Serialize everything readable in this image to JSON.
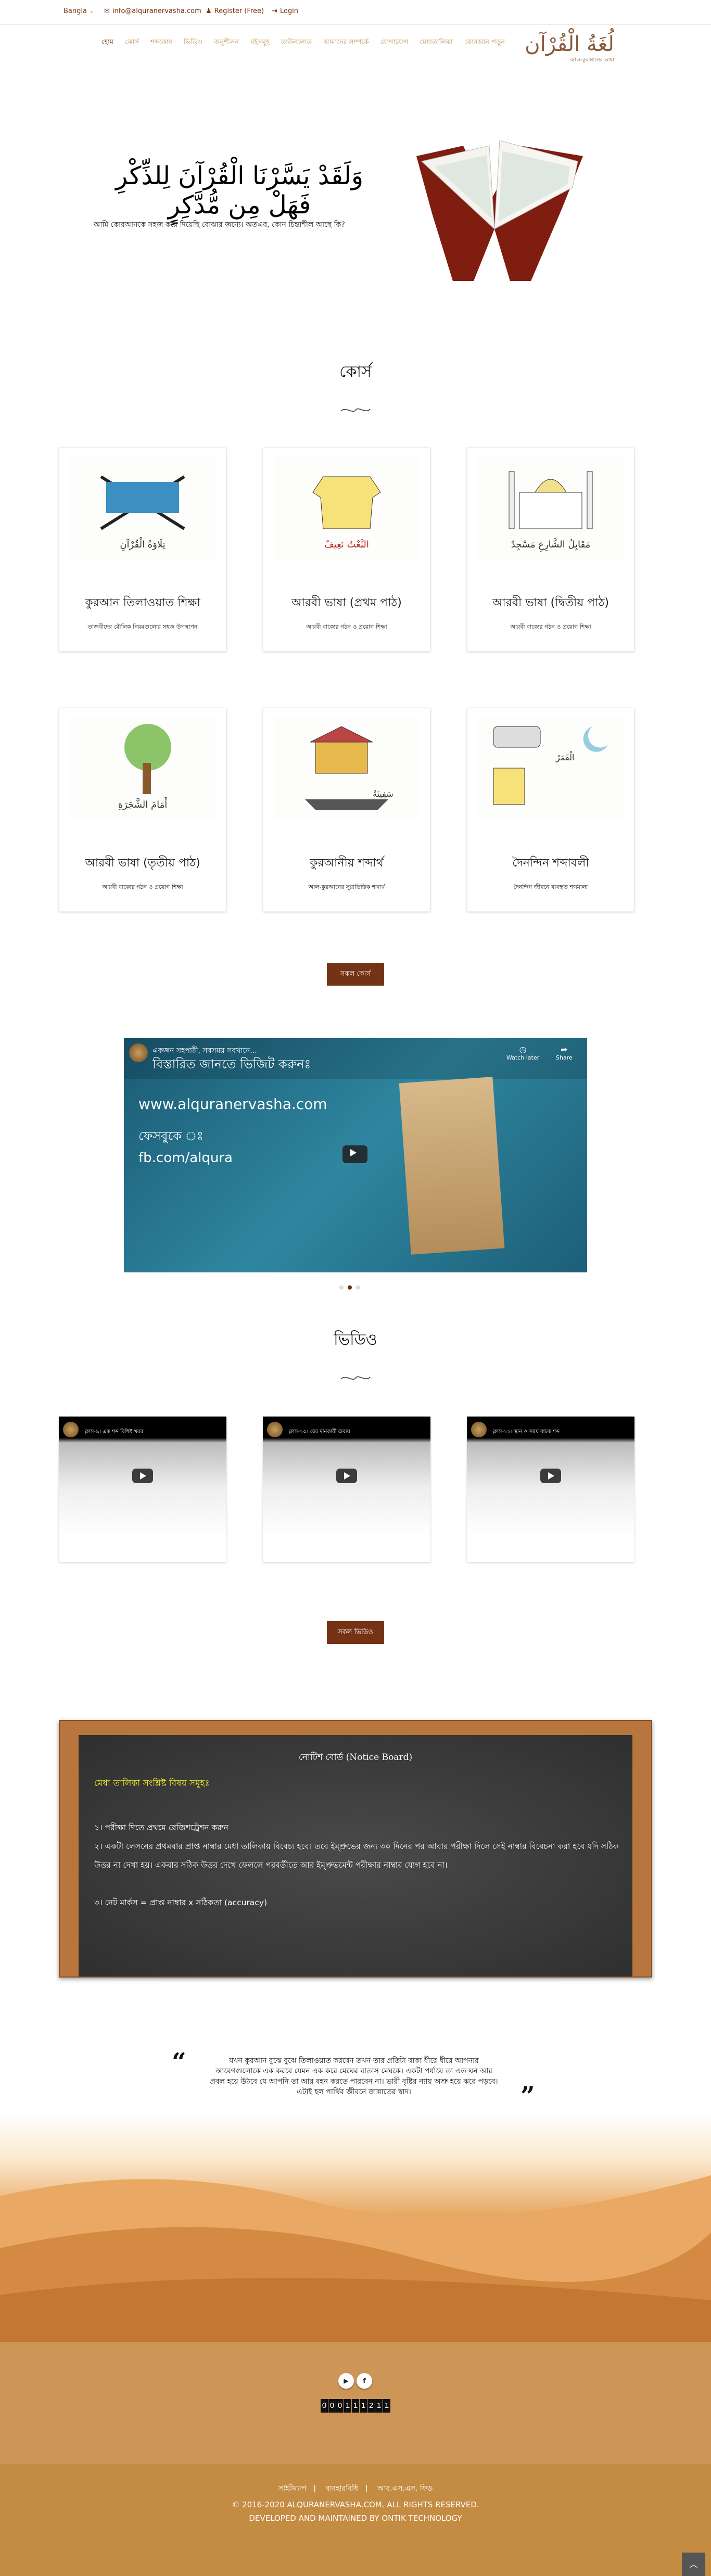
{
  "topbar": {
    "language": "Bangla",
    "email": "info@alquranervasha.com",
    "register": "Register (Free)",
    "login": "Login"
  },
  "nav": [
    "হোম",
    "কোর্স",
    "শব্দকোষ",
    "ভিডিও",
    "অনুশীলন",
    "বইসমূহ",
    "ডাউনলোড",
    "আমাদের সম্পর্কে",
    "যোগাযোগ",
    "মেধাতালিকা",
    "কোরআন পড়ুন"
  ],
  "logo": {
    "arabic": "لُغَةُ الْقُرْآن",
    "subtitle": "আল-কুরআনের ভাষা"
  },
  "hero": {
    "arabic": "وَلَقَدْ يَسَّرْنَا الْقُرْآنَ لِلذِّكْرِ فَهَلْ مِن مُّدَّكِرٍ",
    "bangla": "আমি কোরআনকে সহজ করে দিয়েছি বোঝার জন্যে। অতএব, কোন চিন্তাশীল আছে কি?"
  },
  "courses": {
    "title": "কোর্স",
    "all_label": "সকল কোর্স",
    "items": [
      {
        "title": "কুরআন তিলাওয়াত শিক্ষা",
        "subtitle": "তাজবীদের মৌলিক নিয়মগুলোর সহজ উপস্থাপন",
        "image_text": "تِلَاوَةُ الْقُرْآنِ"
      },
      {
        "title": "আরবী ভাষা (প্রথম পাঠ)",
        "subtitle": "আরবী বাক্যের গঠন ও প্রয়োগ শিক্ষা",
        "image_text": "النَّعْتُ نَعِيفٌ"
      },
      {
        "title": "আরবী ভাষা (দ্বিতীয় পাঠ)",
        "subtitle": "আরবী বাক্যের গঠন ও প্রয়োগ শিক্ষা",
        "image_text": "مَقَابِلُ الشَّارِعِ مَسْجِدٌ"
      },
      {
        "title": "আরবী ভাষা (তৃতীয় পাঠ)",
        "subtitle": "আরবী বাক্যের গঠন ও প্রয়োগ শিক্ষা",
        "image_text": "أَمَامَ الشَّجَرَةِ"
      },
      {
        "title": "কুরআনীয় শব্দার্থ",
        "subtitle": "আল-কুরআনের সুরাভিত্তিক শব্দার্থ",
        "image_text": "سَفِينَةٌ"
      },
      {
        "title": "দৈনন্দিন শব্দাবলী",
        "subtitle": "দৈনন্দিন জীবনে ব্যবহৃত শব্দমালা",
        "image_text": "الْقَمَرُ"
      }
    ]
  },
  "featured_video": {
    "channel_text": "একজন সহপাঠী, সবসময় সবখানে...",
    "line1": "বিস্তারিত জানতে ভিজিট করুনঃ",
    "url": "www.alquranervasha.com",
    "fb_label": "ফেসবুকে ঃ",
    "fb": "fb.com/alqura",
    "watch_later": "Watch later",
    "share": "Share",
    "slide_active": 2,
    "slide_count": 3
  },
  "videos": {
    "title": "ভিডিও",
    "all_label": "সকল ভিডিও",
    "items": [
      {
        "title": "ক্লাস-৯। এক শব্দ বিশিষ্ট খবর"
      },
      {
        "title": "ক্লাস-১০। যের দানকারী অব্যয়"
      },
      {
        "title": "ক্লাস-১১। স্থান ও সময় বাচক শব্দ"
      }
    ]
  },
  "notice": {
    "title": "নোটিশ বোর্ড (Notice Board)",
    "heading": "মেধা তালিকা সংশ্লিষ্ট বিষয় সমুহঃ",
    "lines": [
      "১। পরীক্ষা দিতে প্রথমে রেজিশট্রেশন করুন",
      "২। একটা লেসনের প্রথমবার প্রাপ্ত নাম্বার মেধা তালিকায় বিবেচ্য হবে। তবে ইম্প্রুভের জন্য ৩০ দিনের পর আবার পরীক্ষা দিলে সেই নাম্বার বিবেচনা করা হবে যদি সঠিক উত্তর না দেখা হয়। একবার সঠিক উত্তর দেখে ফেললে পরবর্তীতে আর ইম্প্রুভমেন্ট পরীক্ষার নাম্বার যোগ হবে না।",
      "৩। নেট মার্কস = প্রাপ্ত নাম্বার x সঠিকতা (accuracy)"
    ]
  },
  "quote": {
    "text": "যখন কুরআন বুঝে বুঝে তিলাওয়াত করবেন তখন তার প্রতিটা বাক্য ধীরে ধীরে আপনার আবেগগুলোকে এক করবে যেমন এক করে মেঘের বাতাস মেঘকে। একটা পর্যায়ে তা এত ঘন আর প্রবল হয়ে উঠবে যে আপনি তা আর বহন করতে পারবেন না। ভারী বৃষ্টির ন্যায় অশ্রু হয়ে ঝরে পড়বে। এটাই হল পার্থিব জীবনে জান্নাতের স্বাদ।",
    "open": "“",
    "close": "”"
  },
  "footer": {
    "counter": "000111211",
    "links": [
      "সাইটম্যাপ",
      "ব্যবহারবিধি",
      "আর.এস.এস. ফিড"
    ],
    "copyright": "© 2016-2020 ALQURANERVASHA.COM. ALL RIGHTS RESERVED.",
    "developer": "DEVELOPED AND MAINTAINED BY ONTIK TECHNOLOGY",
    "social": [
      "youtube",
      "facebook"
    ],
    "facebook_glyph": "f"
  },
  "colors": {
    "brand": "#753316",
    "nav": "#c59a5d",
    "footer": "#c48b42"
  }
}
